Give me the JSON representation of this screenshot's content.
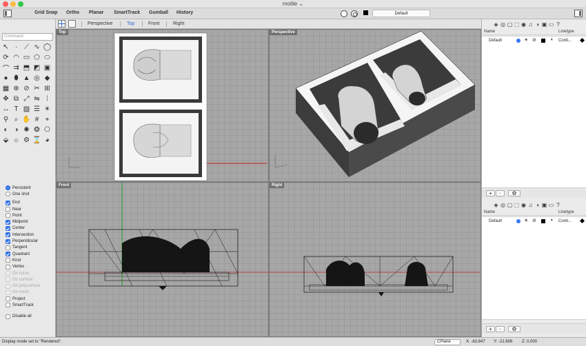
{
  "window": {
    "title": "motile ⌄"
  },
  "toolbar": {
    "items": [
      "Grid Snap",
      "Ortho",
      "Planar",
      "SmartTrack",
      "Gumball",
      "History"
    ],
    "layer": "Default"
  },
  "command": {
    "placeholder": "Command"
  },
  "viewport_tabs": [
    "Perspective",
    "Top",
    "Front",
    "Right"
  ],
  "active_tab": "Top",
  "viewports": {
    "top": "Top",
    "perspective": "Perspective",
    "front": "Front",
    "right": "Right"
  },
  "osnap": {
    "modes": [
      {
        "label": "Persistent",
        "selected": true
      },
      {
        "label": "One shot",
        "selected": false
      }
    ],
    "items": [
      {
        "label": "End",
        "checked": true,
        "disabled": false
      },
      {
        "label": "Near",
        "checked": false,
        "disabled": false
      },
      {
        "label": "Point",
        "checked": false,
        "disabled": false
      },
      {
        "label": "Midpoint",
        "checked": true,
        "disabled": false
      },
      {
        "label": "Center",
        "checked": true,
        "disabled": false
      },
      {
        "label": "Intersection",
        "checked": true,
        "disabled": false
      },
      {
        "label": "Perpendicular",
        "checked": true,
        "disabled": false
      },
      {
        "label": "Tangent",
        "checked": false,
        "disabled": false
      },
      {
        "label": "Quadrant",
        "checked": true,
        "disabled": false
      },
      {
        "label": "Knot",
        "checked": false,
        "disabled": false
      },
      {
        "label": "Vertex",
        "checked": false,
        "disabled": false
      },
      {
        "label": "On curve",
        "checked": false,
        "disabled": true
      },
      {
        "label": "On surface",
        "checked": false,
        "disabled": true
      },
      {
        "label": "On polysurface",
        "checked": false,
        "disabled": true
      },
      {
        "label": "On mesh",
        "checked": false,
        "disabled": true
      },
      {
        "label": "Project",
        "checked": false,
        "disabled": false
      },
      {
        "label": "SmartTrack",
        "checked": false,
        "disabled": false
      }
    ],
    "disable_all": "Disable all"
  },
  "layers_panel": {
    "col_name": "Name",
    "col_linetype": "Linetype",
    "row": {
      "name": "Default",
      "linetype": "Conti..."
    }
  },
  "status": {
    "message": "Display mode set to \"Rendered\".",
    "cplane": "CPlane",
    "x": "X: -83.847",
    "y": "Y: -21.606",
    "z": "Z: 0.000"
  },
  "colors": {
    "accent": "#3478f6",
    "viewport_bg": "#a7a7a7",
    "axis_red": "#c02020",
    "axis_green": "#1e9a1e"
  }
}
